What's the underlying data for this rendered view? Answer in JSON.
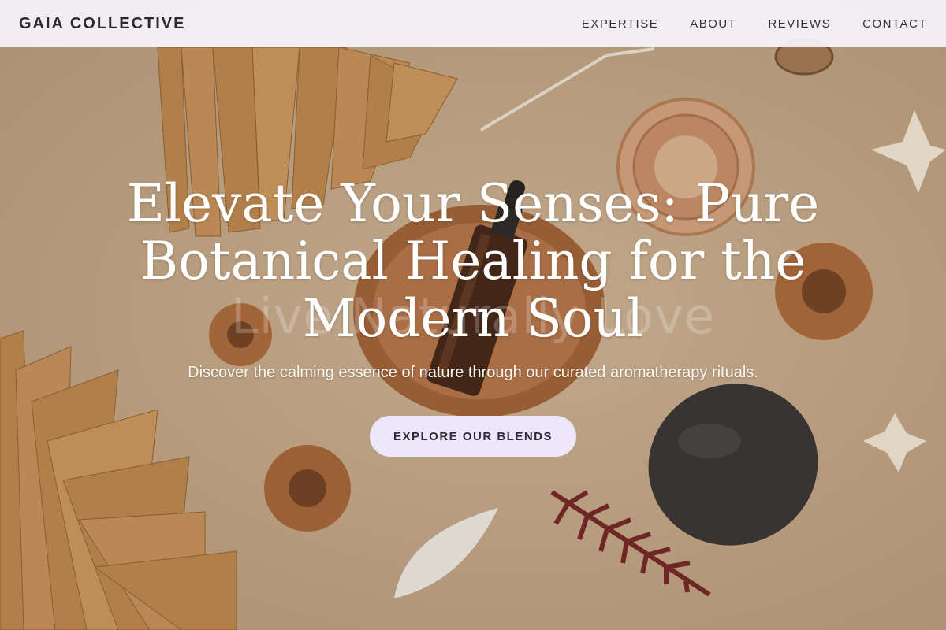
{
  "header": {
    "brand": "GAIA COLLECTIVE",
    "nav": [
      {
        "label": "EXPERTISE"
      },
      {
        "label": "ABOUT"
      },
      {
        "label": "REVIEWS"
      },
      {
        "label": "CONTACT"
      }
    ]
  },
  "hero": {
    "headline": "Elevate Your Senses: Pure Botanical Healing for the Modern Soul",
    "ghost_text": "Live Naturally Love",
    "subtitle": "Discover the calming essence of nature through our curated aromatherapy rituals.",
    "cta_label": "EXPLORE OUR BLENDS"
  },
  "colors": {
    "background": "#c4ab8c",
    "header_bg": "#f6f4fc",
    "cta_bg": "#ece8fa",
    "headline": "#ffffff"
  }
}
